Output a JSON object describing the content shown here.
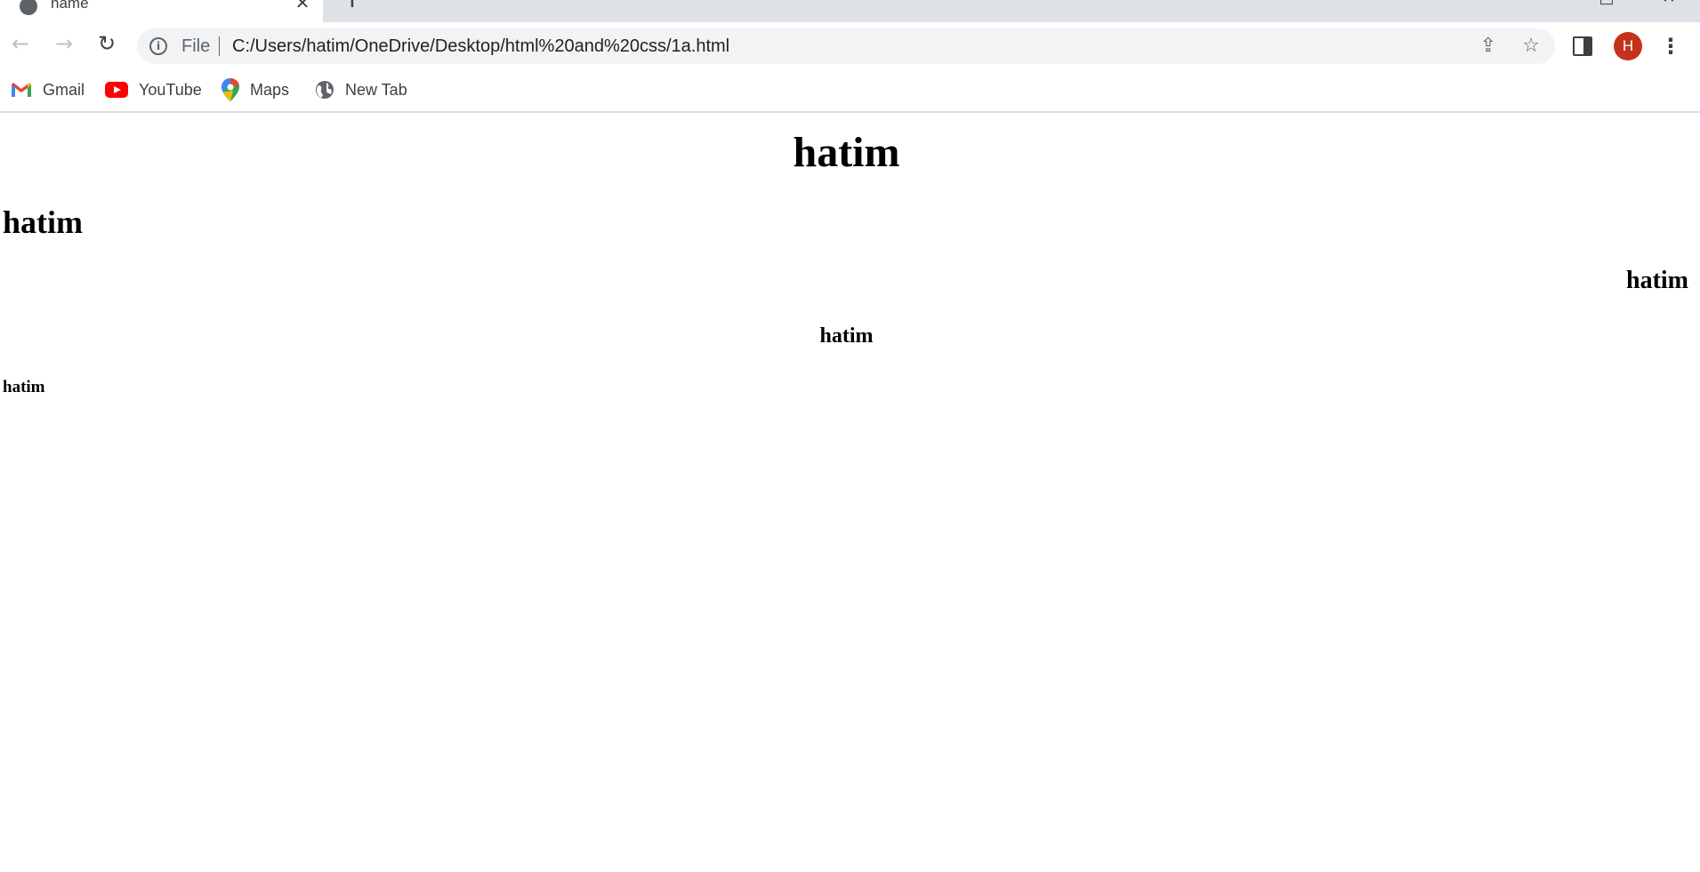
{
  "browser": {
    "tab": {
      "title": "name"
    },
    "address": {
      "scheme_label": "File",
      "url": "C:/Users/hatim/OneDrive/Desktop/html%20and%20css/1a.html"
    },
    "profile_initial": "H",
    "bookmarks": [
      {
        "label": "Gmail",
        "icon": "gmail-icon"
      },
      {
        "label": "YouTube",
        "icon": "youtube-icon"
      },
      {
        "label": "Maps",
        "icon": "maps-icon"
      },
      {
        "label": "New Tab",
        "icon": "globe-icon"
      }
    ]
  },
  "page": {
    "headings": [
      {
        "text": "hatim",
        "level": 1,
        "align": "center"
      },
      {
        "text": "hatim",
        "level": 2,
        "align": "left"
      },
      {
        "text": "hatim",
        "level": 3,
        "align": "right"
      },
      {
        "text": "hatim",
        "level": 4,
        "align": "center"
      },
      {
        "text": "hatim",
        "level": 5,
        "align": "left"
      }
    ]
  }
}
